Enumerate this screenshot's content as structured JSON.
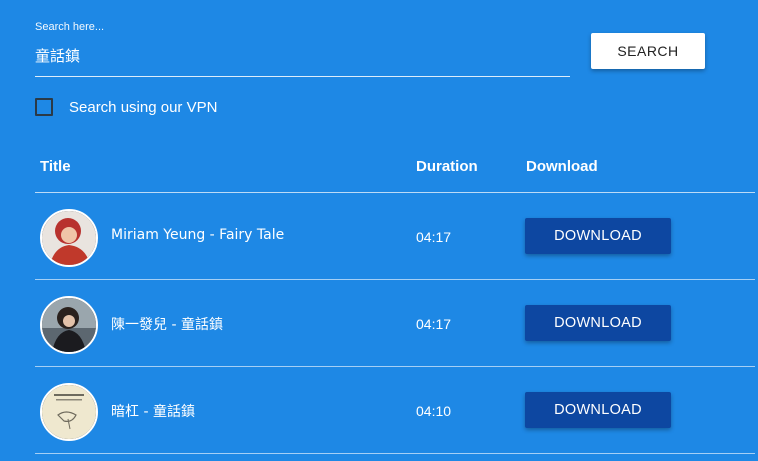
{
  "search": {
    "label": "Search here...",
    "value": "童話鎮",
    "button_label": "SEARCH"
  },
  "vpn": {
    "label": "Search using our VPN",
    "checked": false
  },
  "table": {
    "headers": {
      "title": "Title",
      "duration": "Duration",
      "download": "Download"
    },
    "rows": [
      {
        "title": "Miriam Yeung - Fairy Tale",
        "duration": "04:17",
        "download_label": "DOWNLOAD"
      },
      {
        "title": "陳一發兒 - 童話鎮",
        "duration": "04:17",
        "download_label": "DOWNLOAD"
      },
      {
        "title": "暗杠 - 童話鎮",
        "duration": "04:10",
        "download_label": "DOWNLOAD"
      }
    ]
  },
  "colors": {
    "background": "#1e88e5",
    "download_button": "#0d47a1",
    "search_button": "#ffffff"
  }
}
